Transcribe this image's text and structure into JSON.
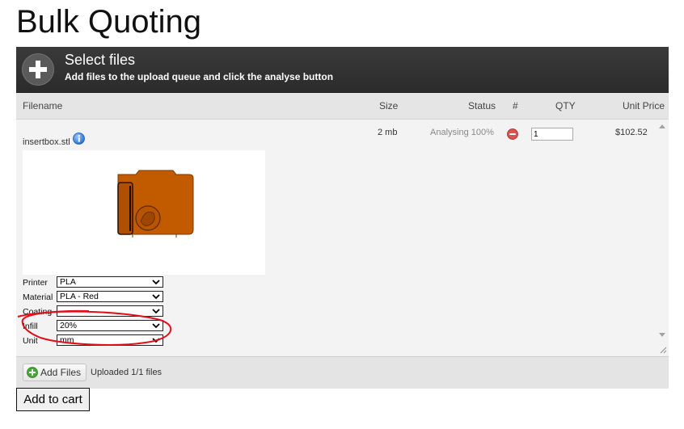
{
  "page": {
    "title": "Bulk Quoting"
  },
  "header": {
    "title": "Select files",
    "subtitle": "Add files to the upload queue and click the analyse button",
    "icon": "plus-icon"
  },
  "columns": {
    "filename": "Filename",
    "size": "Size",
    "status": "Status",
    "count": "#",
    "qty": "QTY",
    "unit_price": "Unit Price"
  },
  "file": {
    "name": "insertbox.stl",
    "size": "2 mb",
    "status": "Analysing 100%",
    "qty": "1",
    "unit_price": "$102.52",
    "options": [
      {
        "label": "Printer",
        "value": "PLA"
      },
      {
        "label": "Material",
        "value": "PLA - Red"
      },
      {
        "label": "Coating",
        "value": ""
      },
      {
        "label": "Infill",
        "value": "20%"
      },
      {
        "label": "Unit",
        "value": "mm"
      }
    ]
  },
  "footer": {
    "add_files_label": "Add Files",
    "upload_status": "Uploaded 1/1 files"
  },
  "cart": {
    "label": "Add to cart"
  },
  "colors": {
    "header_bg": "#2f2f2f",
    "model_orange": "#c25a00",
    "annotation_red": "#e0101a",
    "remove_red": "#d9534f",
    "info_blue": "#3a7fd5",
    "add_green": "#4aa83a"
  }
}
